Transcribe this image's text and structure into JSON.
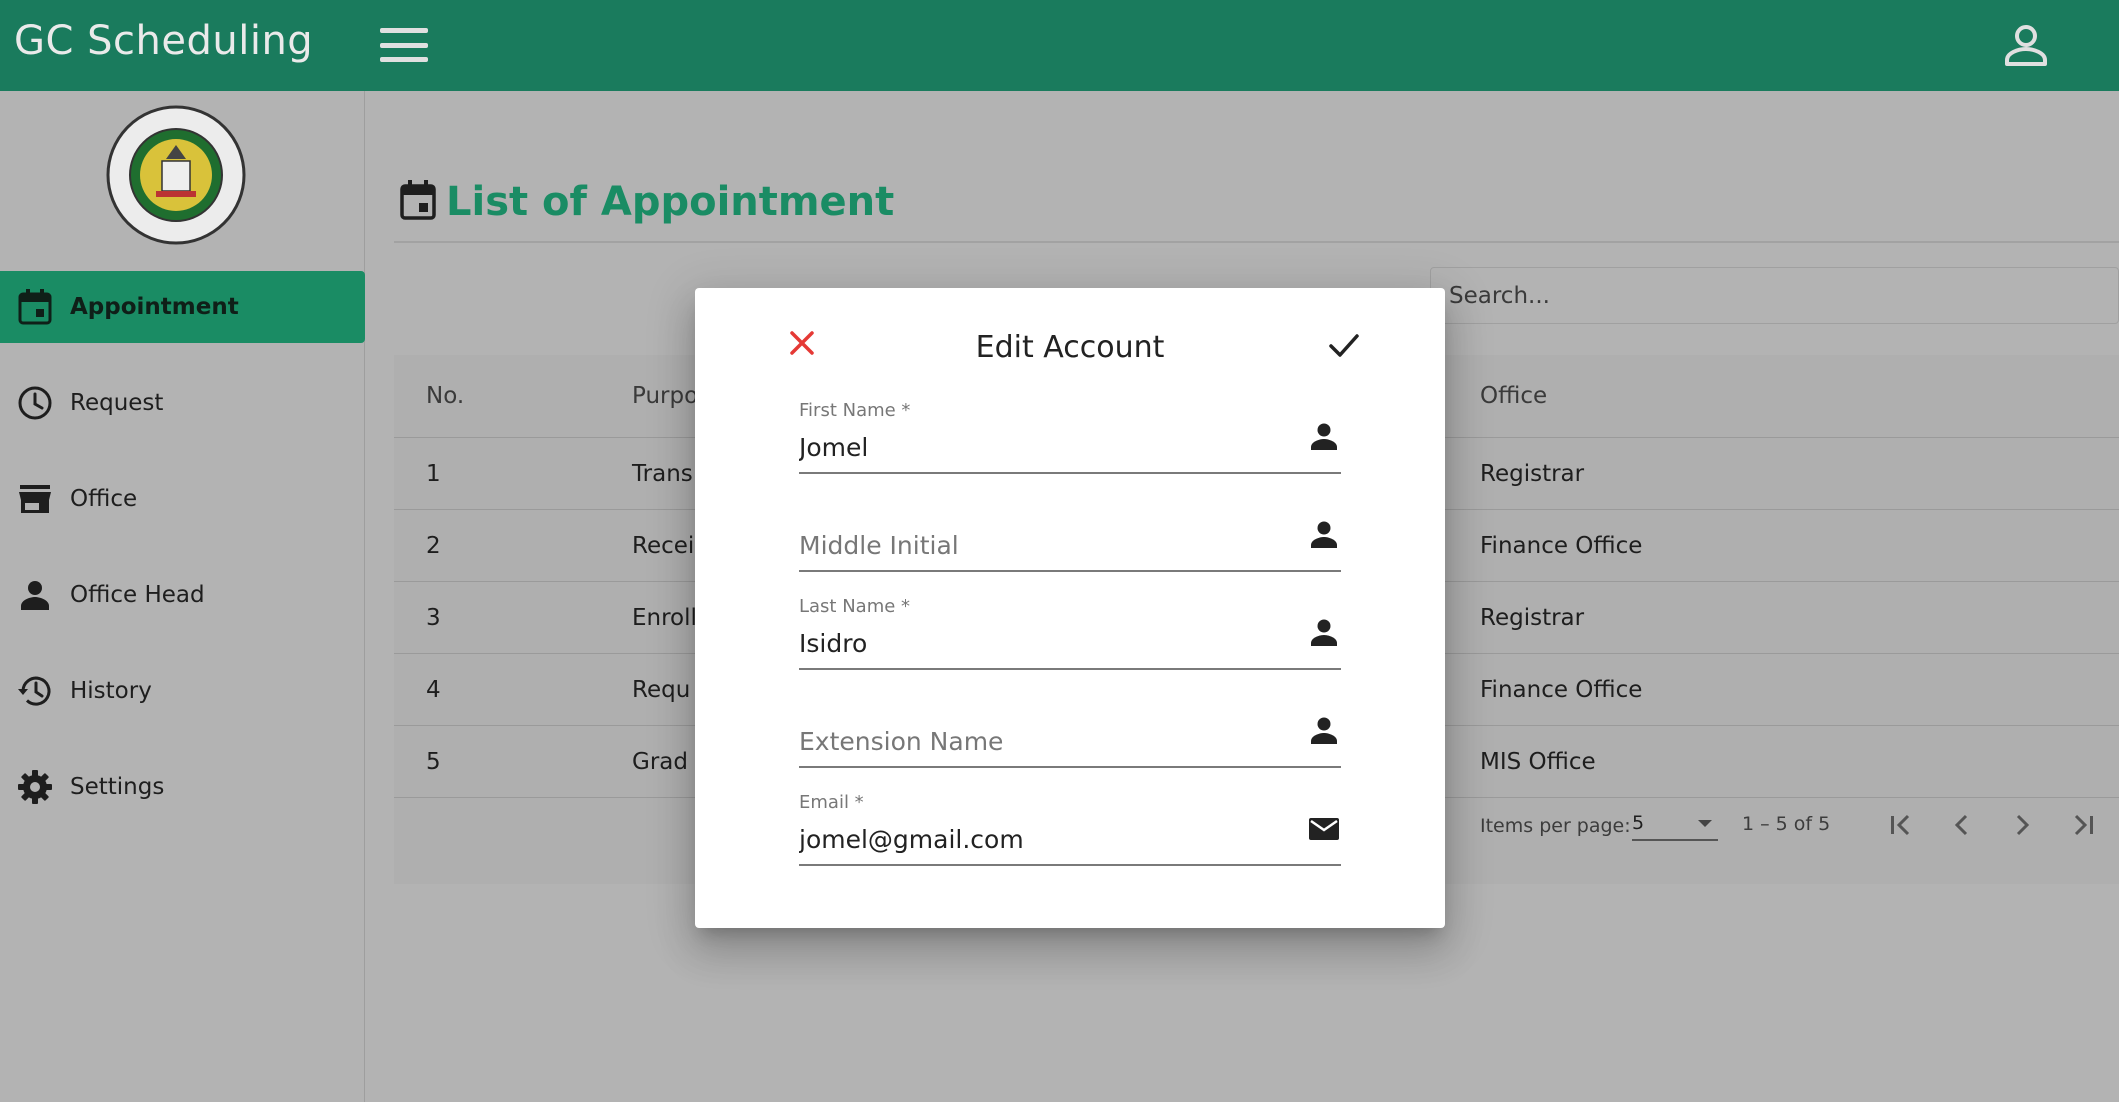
{
  "app": {
    "title": "GC Scheduling"
  },
  "sidebar": {
    "items": [
      {
        "label": "Appointment",
        "icon": "calendar-icon",
        "active": true
      },
      {
        "label": "Request",
        "icon": "clock-icon",
        "active": false
      },
      {
        "label": "Office",
        "icon": "store-icon",
        "active": false
      },
      {
        "label": "Office Head",
        "icon": "person-icon",
        "active": false
      },
      {
        "label": "History",
        "icon": "history-icon",
        "active": false
      },
      {
        "label": "Settings",
        "icon": "gear-icon",
        "active": false
      }
    ]
  },
  "main": {
    "title": "List of Appointment",
    "search_placeholder": "Search...",
    "columns": [
      "No.",
      "Purpo",
      "Office"
    ],
    "rows": [
      {
        "no": "1",
        "purpose": "Trans",
        "office": "Registrar"
      },
      {
        "no": "2",
        "purpose": "Recei",
        "office": "Finance Office"
      },
      {
        "no": "3",
        "purpose": "Enroll",
        "office": "Registrar"
      },
      {
        "no": "4",
        "purpose": "Requ",
        "office": "Finance Office"
      },
      {
        "no": "5",
        "purpose": "Grad",
        "office": "MIS Office"
      }
    ],
    "paginator": {
      "items_per_page_label": "Items per page:",
      "items_per_page_value": "5",
      "range_label": "1 – 5 of 5"
    }
  },
  "dialog": {
    "title": "Edit Account",
    "fields": {
      "first_name": {
        "label": "First Name *",
        "value": "Jomel"
      },
      "middle_initial": {
        "placeholder": "Middle Initial",
        "value": ""
      },
      "last_name": {
        "label": "Last Name *",
        "value": "Isidro"
      },
      "extension_name": {
        "placeholder": "Extension Name",
        "value": ""
      },
      "email": {
        "label": "Email *",
        "value": "jomel@gmail.com"
      }
    }
  },
  "colors": {
    "brand": "#1a7b5d",
    "accent": "#1a8c64",
    "close": "#e53935"
  }
}
